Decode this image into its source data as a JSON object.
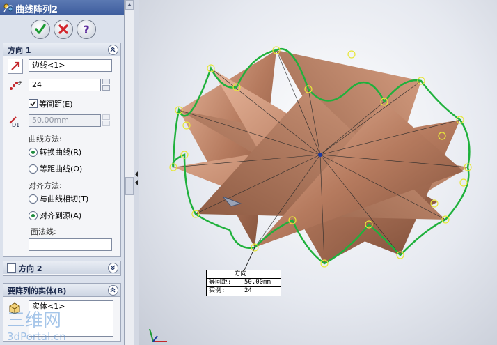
{
  "title": "曲线阵列2",
  "buttons": {
    "ok": "ok-check-icon",
    "cancel": "cancel-x-icon",
    "help": "help-question-icon"
  },
  "direction1": {
    "header": "方向 1",
    "edge_value": "边线<1>",
    "count_value": "24",
    "equal_spacing_label": "等间距(E)",
    "equal_spacing_checked": true,
    "spacing_value": "50.00mm",
    "curve_method_label": "曲线方法:",
    "transform_curve_label": "转换曲线(R)",
    "offset_curve_label": "等距曲线(O)",
    "align_method_label": "对齐方法:",
    "tangent_label": "与曲线相切(T)",
    "align_origin_label": "对齐到源(A)",
    "face_normal_label": "面法线:",
    "face_normal_value": ""
  },
  "direction2": {
    "header": "方向 2",
    "checked": false
  },
  "bodies": {
    "header": "要阵列的实体(B)",
    "item": "实体<1>"
  },
  "callout": {
    "title": "方向一",
    "spacing_label": "等间距:",
    "spacing_value": "50.00mm",
    "count_label": "实例:",
    "count_value": "24"
  },
  "watermark": {
    "line1": "三维网",
    "line2": "3dPortal.cn"
  },
  "colors": {
    "accent_green": "#1fb13c",
    "body_copper": "#b57a5e",
    "title_blue": "#3d5c9c"
  }
}
